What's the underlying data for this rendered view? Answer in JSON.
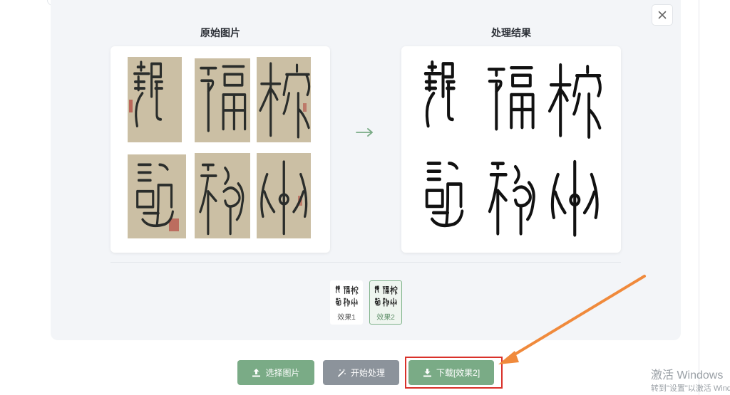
{
  "sections": {
    "original_title": "原始图片",
    "result_title": "处理结果"
  },
  "colors": {
    "accent_green": "#7aab86",
    "neutral_gray": "#8c939b",
    "highlight_red": "#d9312a",
    "annotation_orange": "#f08a3c",
    "paper_tan": "#cbbfa4",
    "seal_red": "#b3413b"
  },
  "icons": {
    "close": "close-icon",
    "arrow": "arrow-right-icon",
    "upload": "upload-icon",
    "wand": "magic-wand-icon",
    "download": "download-icon"
  },
  "thumbnails": [
    {
      "label": "效果1",
      "selected": false
    },
    {
      "label": "效果2",
      "selected": true
    }
  ],
  "toolbar": {
    "select_label": "选择图片",
    "start_label": "开始处理",
    "download_label": "下载[效果2]"
  },
  "watermark": {
    "line1": "激活 Windows",
    "line2": "转到\"设置\"以激活 Windows。"
  }
}
